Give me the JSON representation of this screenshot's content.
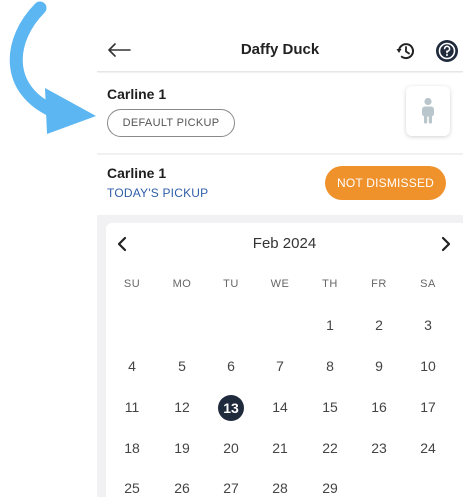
{
  "header": {
    "title": "Daffy Duck"
  },
  "default_card": {
    "name": "Carline 1",
    "pill_label": "DEFAULT PICKUP"
  },
  "today_card": {
    "name": "Carline 1",
    "subtitle": "TODAY'S PICKUP",
    "status_label": "NOT DISMISSED",
    "status_color": "#f0922b"
  },
  "calendar": {
    "month_label": "Feb 2024",
    "weekdays": [
      "SU",
      "MO",
      "TU",
      "WE",
      "TH",
      "FR",
      "SA"
    ],
    "weeks": [
      [
        "",
        "",
        "",
        "",
        "1",
        "2",
        "3"
      ],
      [
        "4",
        "5",
        "6",
        "7",
        "8",
        "9",
        "10"
      ],
      [
        "11",
        "12",
        "13",
        "14",
        "15",
        "16",
        "17"
      ],
      [
        "18",
        "19",
        "20",
        "21",
        "22",
        "23",
        "24"
      ],
      [
        "25",
        "26",
        "27",
        "28",
        "29",
        "",
        ""
      ]
    ],
    "selected_day": "13"
  },
  "colors": {
    "accent_blue": "#2f5fa8",
    "arrow": "#5bb6f2",
    "selected_day_bg": "#1f2a3d"
  }
}
